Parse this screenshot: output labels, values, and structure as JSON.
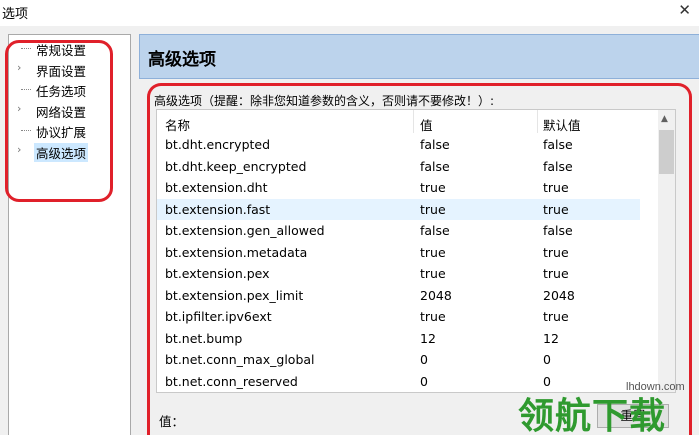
{
  "window": {
    "title": "选项",
    "close_glyph": "✕"
  },
  "tree": {
    "items": [
      {
        "label": "常规设置",
        "has_children": false,
        "selected": false
      },
      {
        "label": "界面设置",
        "has_children": true,
        "selected": false
      },
      {
        "label": "任务选项",
        "has_children": false,
        "selected": false
      },
      {
        "label": "网络设置",
        "has_children": true,
        "selected": false
      },
      {
        "label": "协议扩展",
        "has_children": false,
        "selected": false
      },
      {
        "label": "高级选项",
        "has_children": true,
        "selected": true
      }
    ]
  },
  "panel": {
    "header_title": "高级选项",
    "group_caption": "高级选项（提醒：除非您知道参数的含义，否则请不要修改！）:",
    "columns": {
      "name": "名称",
      "value": "值",
      "default": "默认值"
    },
    "rows": [
      {
        "name": "bt.dht.encrypted",
        "value": "false",
        "default": "false"
      },
      {
        "name": "bt.dht.keep_encrypted",
        "value": "false",
        "default": "false"
      },
      {
        "name": "bt.extension.dht",
        "value": "true",
        "default": "true"
      },
      {
        "name": "bt.extension.fast",
        "value": "true",
        "default": "true",
        "selected": true
      },
      {
        "name": "bt.extension.gen_allowed",
        "value": "false",
        "default": "false"
      },
      {
        "name": "bt.extension.metadata",
        "value": "true",
        "default": "true"
      },
      {
        "name": "bt.extension.pex",
        "value": "true",
        "default": "true"
      },
      {
        "name": "bt.extension.pex_limit",
        "value": "2048",
        "default": "2048"
      },
      {
        "name": "bt.ipfilter.ipv6ext",
        "value": "true",
        "default": "true"
      },
      {
        "name": "bt.net.bump",
        "value": "12",
        "default": "12"
      },
      {
        "name": "bt.net.conn_max_global",
        "value": "0",
        "default": "0"
      },
      {
        "name": "bt.net.conn_reserved",
        "value": "0",
        "default": "0"
      }
    ],
    "value_label": "值：",
    "reset_button": "重置"
  },
  "watermark": {
    "text": "领航下载",
    "url": "lhdown.com"
  },
  "colors": {
    "annotation": "#e0202a",
    "header_bg": "#bcd3ec",
    "selection": "#cce8ff"
  }
}
